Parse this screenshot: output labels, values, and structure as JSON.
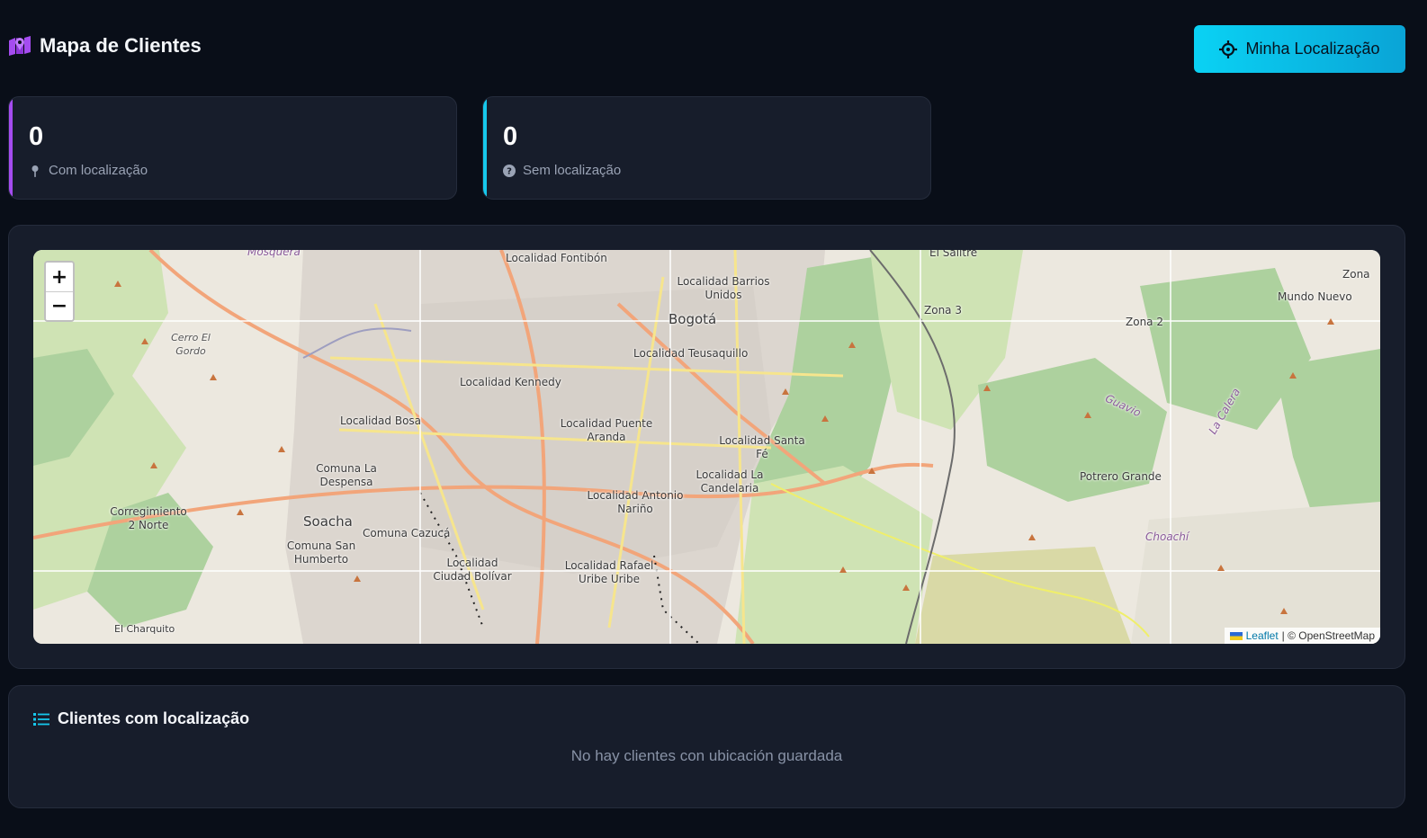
{
  "header": {
    "title": "Mapa de Clientes",
    "title_icon": "map-location-icon",
    "locate_button": "Minha Localização",
    "locate_icon": "crosshairs-icon"
  },
  "stats": [
    {
      "value": "0",
      "label": "Com localização",
      "icon": "map-pin-icon",
      "accent": "#a54cf0"
    },
    {
      "value": "0",
      "label": "Sem localização",
      "icon": "question-circle-icon",
      "accent": "#16c8ec"
    }
  ],
  "map": {
    "zoom_in": "+",
    "zoom_out": "−",
    "attribution_link": "Leaflet",
    "attribution_text": "| © OpenStreetMap",
    "places": [
      "Mosquera",
      "Localidad Fontibón",
      "Localidad Barrios Unidos",
      "Bogotá",
      "El Salitre",
      "Zona",
      "Mundo Nuevo",
      "Zona 3",
      "Zona 2",
      "Cerro El Gordo",
      "Localidad Teusaquillo",
      "Localidad Kennedy",
      "Localidad Bosa",
      "Localidad Puente Aranda",
      "Localidad Santa Fé",
      "Guavio",
      "La Calera",
      "Comuna La Despensa",
      "Localidad La Candelaria",
      "Potrero Grande",
      "Corregimiento 2 Norte",
      "Soacha",
      "Localidad Antonio Nariño",
      "Comuna Cazucá",
      "Choachí",
      "Comuna San Humberto",
      "Localidad Ciudad Bolívar",
      "Localidad Rafael Uribe Uribe",
      "El Charquito"
    ]
  },
  "list": {
    "title": "Clientes com localização",
    "icon": "list-icon",
    "empty_message": "No hay clientes con ubicación guardada"
  },
  "colors": {
    "background": "#090e18",
    "panel": "#171d2b",
    "accent_cyan": "#0ad2f4",
    "accent_purple": "#a54cf0"
  }
}
